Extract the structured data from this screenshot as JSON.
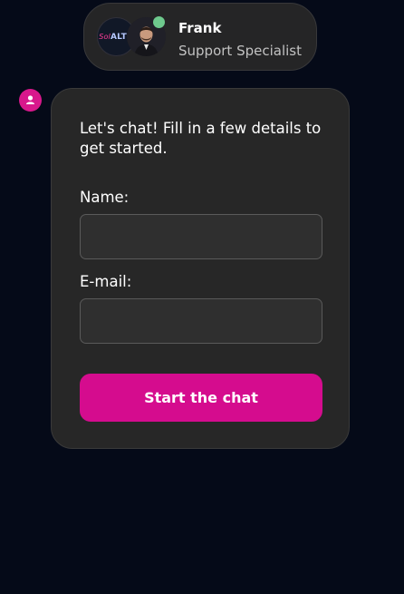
{
  "agent": {
    "name": "Frank",
    "role": "Support Specialist",
    "status": "online",
    "status_color": "#6ec98d",
    "logo_text": "ALTO",
    "logo_script": "Sol"
  },
  "chat_form": {
    "intro": "Let's chat! Fill in a few details to get started.",
    "name_label": "Name:",
    "name_value": "",
    "email_label": "E-mail:",
    "email_value": "",
    "submit_label": "Start the chat"
  },
  "icons": {
    "bot_avatar": "person-icon",
    "online_indicator": "status-dot-icon"
  },
  "colors": {
    "background": "#050a18",
    "card": "#272727",
    "accent": "#d50c8e"
  }
}
